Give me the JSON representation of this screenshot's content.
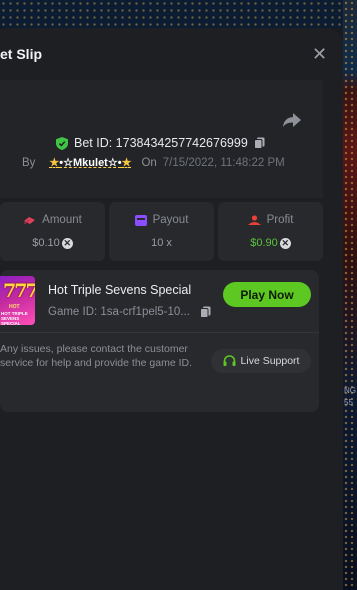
{
  "modal": {
    "title": "et Slip",
    "close_icon": "close-icon"
  },
  "bet": {
    "id_label": "Bet ID: 1738434257742676999",
    "by_label": "By",
    "username": "•☆Mkulet☆•",
    "on_label": "On",
    "date": "7/15/2022, 11:48:22 PM"
  },
  "stats": [
    {
      "label": "Amount",
      "value": "$0.10",
      "icon": "stack-icon",
      "color": "#e0405a"
    },
    {
      "label": "Payout",
      "value": "10 x",
      "icon": "payout-icon",
      "color": "#8a4dff"
    },
    {
      "label": "Profit",
      "value": "$0.90",
      "icon": "profit-icon",
      "color": "#e8413a"
    }
  ],
  "game": {
    "name": "Hot Triple Sevens Special",
    "id_text": "Game ID: 1sa-crf1pel5-10...",
    "thumb_number": "777",
    "thumb_hot": "HOT",
    "thumb_text": "HOT TRIPLE SEVENS SPECIAL",
    "play_label": "Play Now",
    "note": "Any issues, please contact the customer service for help and provide the game ID.",
    "support_label": "Live Support"
  },
  "background": {
    "side_text_1": "NG",
    "side_text_2": "55"
  },
  "colors": {
    "accent_green": "#5cc821",
    "profit_green": "#58c53a",
    "shield_green": "#3fc545"
  }
}
